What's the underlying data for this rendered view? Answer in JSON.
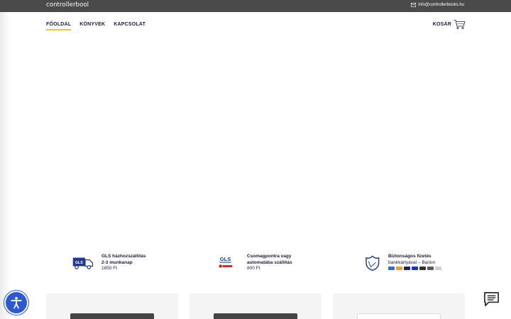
{
  "header": {
    "brand": "controllerbool",
    "email": "info@controllerbooks.hu"
  },
  "nav": {
    "items": [
      {
        "label": "FŐOLDAL",
        "active": true
      },
      {
        "label": "KÖNYVEK",
        "active": false
      },
      {
        "label": "KAPCSOLAT",
        "active": false
      }
    ],
    "cart_label": "KOSÁR"
  },
  "features": [
    {
      "icon": "gls-truck-icon",
      "line1": "GLS házhozszállítás",
      "line2": "2-3 munkanap",
      "line3": "1850 Ft"
    },
    {
      "icon": "gls-foxpost-icon",
      "line1": "Csomagpontra vagy",
      "line2": "automatába szállítás",
      "line3": "800 Ft"
    },
    {
      "icon": "secure-shield-icon",
      "line1": "Biztonságos fizetés",
      "line2": "bankkártyával – Barion"
    }
  ],
  "colors": {
    "topbar": "#4a4a4a",
    "accent": "#f2c318",
    "navy": "#1b1b3a",
    "a11y": "#2c58d6"
  }
}
